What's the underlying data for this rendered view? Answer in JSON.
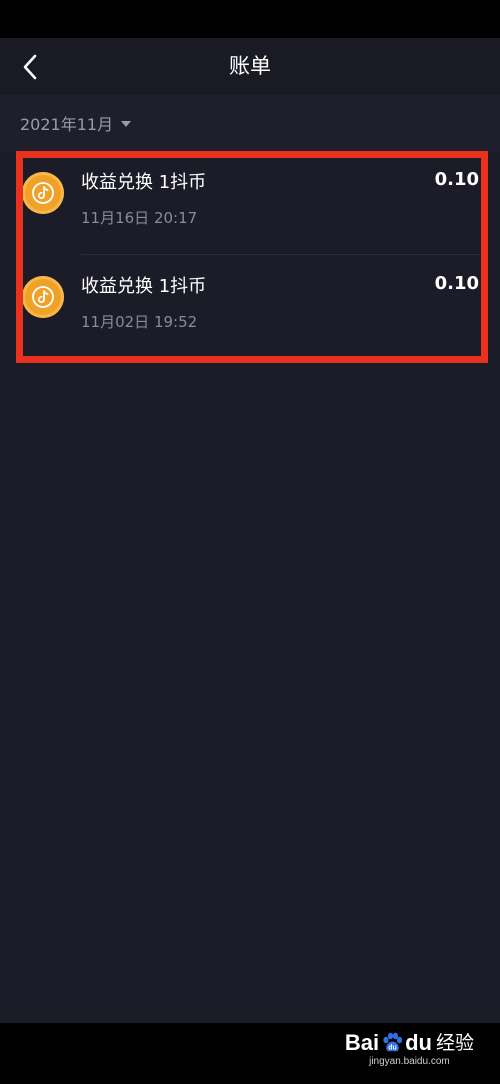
{
  "header": {
    "title": "账单"
  },
  "filter": {
    "month": "2021年11月"
  },
  "bills": [
    {
      "title": "收益兑换 1抖币",
      "time": "11月16日 20:17",
      "amount": "0.10"
    },
    {
      "title": "收益兑换 1抖币",
      "time": "11月02日 19:52",
      "amount": "0.10"
    }
  ],
  "watermark": {
    "brand_left": "Bai",
    "brand_right": "du",
    "brand_suffix": "经验",
    "url": "jingyan.baidu.com"
  },
  "colors": {
    "background": "#1b1c27",
    "coin": "#f0a128",
    "highlight": "#e8321e"
  },
  "icons": {
    "back": "chevron-left-icon",
    "coin": "douyin-coin-icon",
    "dropdown": "caret-down-icon"
  }
}
